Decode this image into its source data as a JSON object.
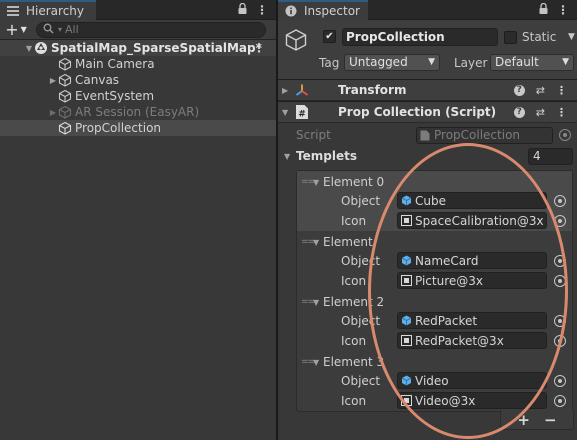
{
  "hierarchy": {
    "tab_label": "Hierarchy",
    "search_placeholder": "All",
    "scene_name": "SpatialMap_SparseSpatialMap*",
    "items": [
      {
        "label": "Main Camera",
        "has_children": false,
        "disabled": false
      },
      {
        "label": "Canvas",
        "has_children": true,
        "disabled": false
      },
      {
        "label": "EventSystem",
        "has_children": false,
        "disabled": false
      },
      {
        "label": "AR Session (EasyAR)",
        "has_children": true,
        "disabled": true
      },
      {
        "label": "PropCollection",
        "has_children": false,
        "disabled": false,
        "selected": true
      }
    ]
  },
  "inspector": {
    "tab_label": "Inspector",
    "object_name": "PropCollection",
    "static_label": "Static",
    "tag_label": "Tag",
    "tag_value": "Untagged",
    "layer_label": "Layer",
    "layer_value": "Default",
    "components": {
      "transform": {
        "title": "Transform"
      },
      "script": {
        "title": "Prop Collection (Script)",
        "script_label": "Script",
        "script_value": "PropCollection"
      }
    },
    "templets": {
      "label": "Templets",
      "size": "4",
      "object_label": "Object",
      "icon_label": "Icon",
      "elements": [
        {
          "label": "Element 0",
          "object": "Cube",
          "icon": "SpaceCalibration@3x"
        },
        {
          "label": "Element",
          "object": "NameCard",
          "icon": "Picture@3x"
        },
        {
          "label": "Element 2",
          "object": "RedPacket",
          "icon": "RedPacket@3x"
        },
        {
          "label": "Element 3",
          "object": "Video",
          "icon": "Video@3x"
        }
      ],
      "add_label": "+",
      "remove_label": "−"
    }
  },
  "colors": {
    "annotation": "#d98a6e",
    "selection": "#4a4a4a",
    "tab_accent": "#2c5d87",
    "prefab_icon": "#5fb0e8"
  }
}
